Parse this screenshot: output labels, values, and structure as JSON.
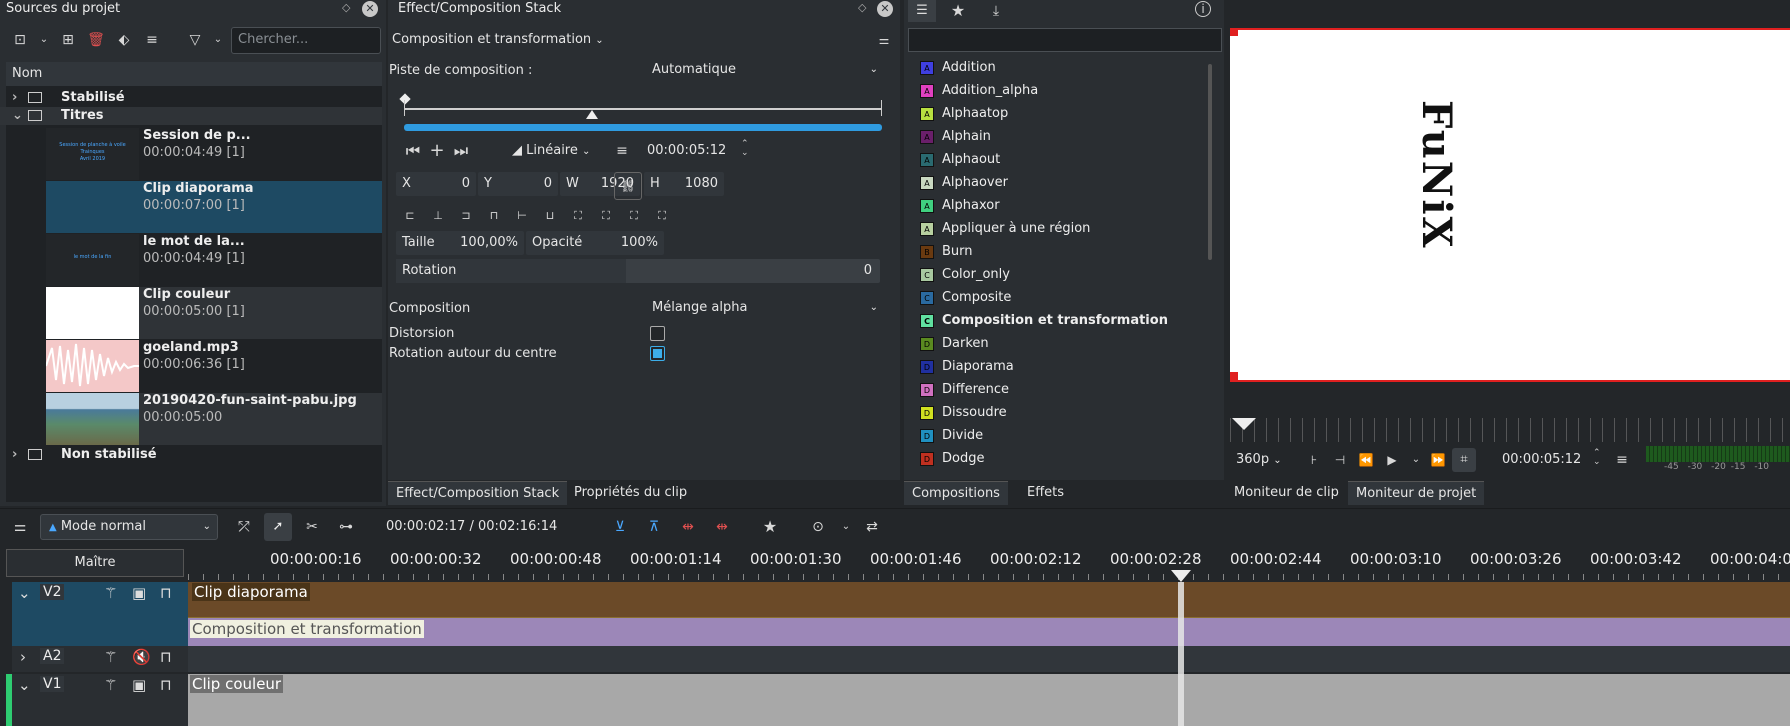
{
  "project_bin": {
    "title": "Sources du projet",
    "search_placeholder": "Chercher...",
    "column_header": "Nom",
    "folders": {
      "stabilise": "Stabilisé",
      "titres": "Titres",
      "non_stabilise": "Non stabilisé"
    },
    "clips": [
      {
        "name": "Session de p...",
        "duration": "00:00:04:49 [1]",
        "thumb_text": "Session de planche à voile\nTrainques\nAvril 2019"
      },
      {
        "name": "Clip diaporama",
        "duration": "00:00:07:00 [1]"
      },
      {
        "name": "le mot de la...",
        "duration": "00:00:04:49 [1]",
        "thumb_text": "le mot de la fin"
      },
      {
        "name": "Clip couleur",
        "duration": "00:00:05:00 [1]"
      },
      {
        "name": "goeland.mp3",
        "duration": "00:00:06:36 [1]"
      },
      {
        "name": "20190420-fun-saint-pabu.jpg",
        "duration": "00:00:05:00"
      }
    ],
    "tabs": {
      "effect_stack": "Effect/Composition Stack",
      "clip_props": "Propriétés du clip"
    }
  },
  "effect_stack": {
    "title": "Effect/Composition Stack",
    "composition_name": "Composition et transformation",
    "track_label": "Piste de composition :",
    "track_value": "Automatique",
    "interp": "Linéaire",
    "timecode": "00:00:05:12",
    "x_label": "X",
    "x_val": "0",
    "y_label": "Y",
    "y_val": "0",
    "w_label": "W",
    "w_val": "1920",
    "h_label": "H",
    "h_val": "1080",
    "size_label": "Taille",
    "size_val": "100,00%",
    "opacity_label": "Opacité",
    "opacity_val": "100%",
    "rotation_label": "Rotation",
    "rotation_val": "0",
    "composition_label": "Composition",
    "composition_value": "Mélange alpha",
    "distortion_label": "Distorsion",
    "rotate_center_label": "Rotation autour du centre",
    "distortion_checked": false,
    "rotate_center_checked": true
  },
  "compositions": {
    "items": [
      {
        "name": "Addition",
        "badge": "A",
        "color": "#3f3fe0"
      },
      {
        "name": "Addition_alpha",
        "badge": "A",
        "color": "#e040c0"
      },
      {
        "name": "Alphaatop",
        "badge": "A",
        "color": "#b8e040"
      },
      {
        "name": "Alphain",
        "badge": "A",
        "color": "#6a1f6a"
      },
      {
        "name": "Alphaout",
        "badge": "A",
        "color": "#2a6a70"
      },
      {
        "name": "Alphaover",
        "badge": "A",
        "color": "#c8d8c0"
      },
      {
        "name": "Alphaxor",
        "badge": "A",
        "color": "#40d080"
      },
      {
        "name": "Appliquer à une région",
        "badge": "A",
        "color": "#b8d0a0"
      },
      {
        "name": "Burn",
        "badge": "B",
        "color": "#6a3a10"
      },
      {
        "name": "Color_only",
        "badge": "C",
        "color": "#a8c8a0"
      },
      {
        "name": "Composite",
        "badge": "C",
        "color": "#2a6aa0"
      },
      {
        "name": "Composition et transformation",
        "badge": "C",
        "color": "#60e0a0",
        "bold": true
      },
      {
        "name": "Darken",
        "badge": "D",
        "color": "#5a8a20"
      },
      {
        "name": "Diaporama",
        "badge": "D",
        "color": "#2030a0"
      },
      {
        "name": "Difference",
        "badge": "D",
        "color": "#d070c0"
      },
      {
        "name": "Dissoudre",
        "badge": "D",
        "color": "#d0e020"
      },
      {
        "name": "Divide",
        "badge": "D",
        "color": "#2090c0"
      },
      {
        "name": "Dodge",
        "badge": "D",
        "color": "#c03020"
      }
    ],
    "tabs": {
      "compositions": "Compositions",
      "effets": "Effets"
    }
  },
  "monitor": {
    "preview_text": "FuNiX",
    "zoom": "360p",
    "timecode": "00:00:05:12",
    "meter_labels": [
      "-45",
      "-30",
      "-20",
      "-15",
      "-10"
    ],
    "tabs": {
      "clip": "Moniteur de clip",
      "project": "Moniteur de projet"
    }
  },
  "timeline": {
    "mode": "Mode normal",
    "position": "00:00:02:17 / 00:02:16:14",
    "master": "Maître",
    "ruler": [
      "00:00:00:16",
      "00:00:00:32",
      "00:00:00:48",
      "00:00:01:14",
      "00:00:01:30",
      "00:00:01:46",
      "00:00:02:12",
      "00:00:02:28",
      "00:00:02:44",
      "00:00:03:10",
      "00:00:03:26",
      "00:00:03:42",
      "00:00:04:0"
    ],
    "tracks": {
      "v2": "V2",
      "a2": "A2",
      "v1": "V1",
      "v2_clip": "Clip diaporama",
      "v2_comp": "Composition et transformation",
      "v1_clip": "Clip couleur"
    }
  }
}
